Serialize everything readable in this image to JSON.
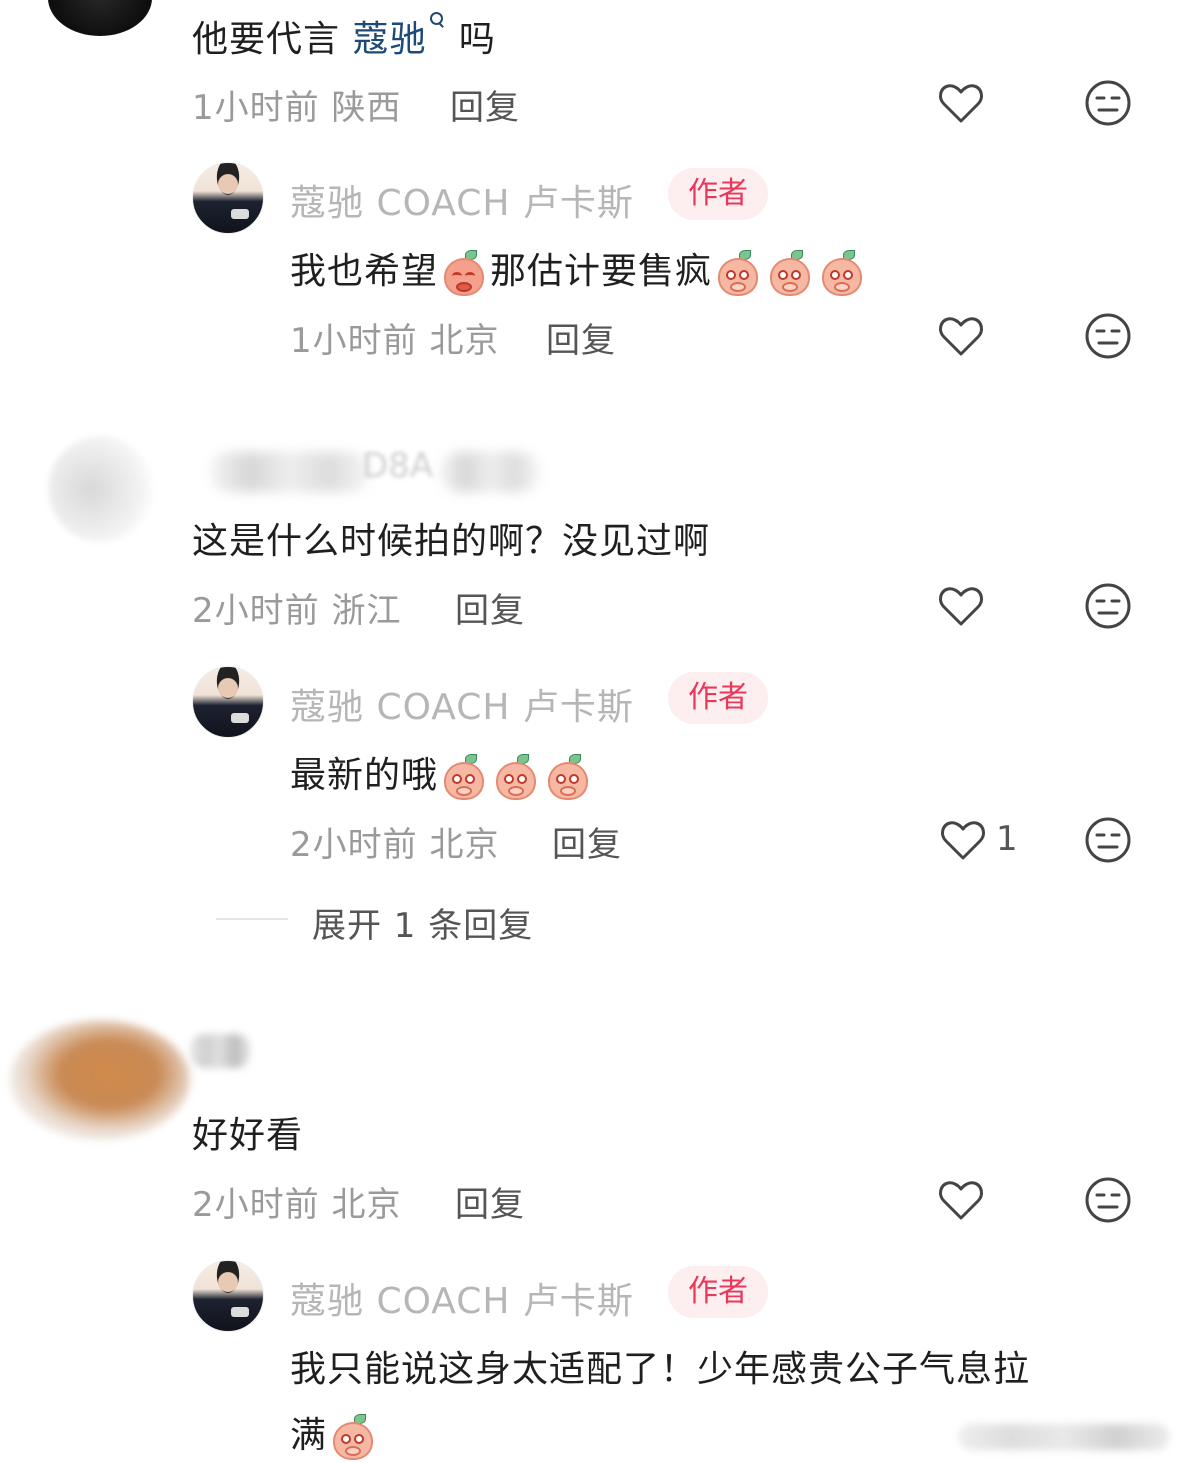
{
  "comments": [
    {
      "text_prefix": "他要代言 ",
      "link": "蔻驰",
      "text_suffix": " 吗",
      "time": "1小时前",
      "location": "陕西",
      "reply_label": "回复",
      "reply": {
        "username": "蔻驰 COACH 卢卡斯",
        "badge": "作者",
        "text_a": "我也希望",
        "text_b": "那估计要售疯",
        "time": "1小时前",
        "location": "北京",
        "reply_label": "回复"
      }
    },
    {
      "username_partial": "D8A",
      "text": "这是什么时候拍的啊？没见过啊",
      "time": "2小时前",
      "location": "浙江",
      "reply_label": "回复",
      "reply": {
        "username": "蔻驰 COACH 卢卡斯",
        "badge": "作者",
        "text": "最新的哦",
        "time": "2小时前",
        "location": "北京",
        "reply_label": "回复",
        "like_count": "1"
      },
      "expand_label": "展开 1 条回复"
    },
    {
      "text": "好好看",
      "time": "2小时前",
      "location": "北京",
      "reply_label": "回复",
      "reply": {
        "username": "蔻驰 COACH 卢卡斯",
        "badge": "作者",
        "text_line1": "我只能说这身太适配了！少年感贵公子气息拉",
        "text_line2": "满"
      }
    }
  ]
}
